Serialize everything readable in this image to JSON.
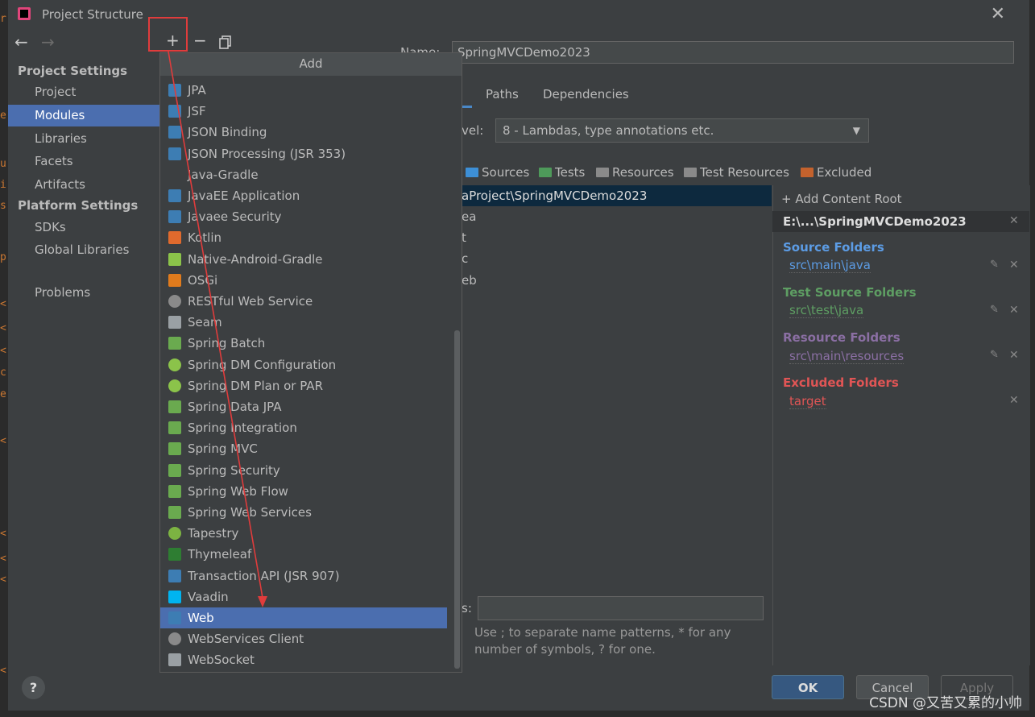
{
  "window": {
    "title": "Project Structure"
  },
  "nav": {
    "back_icon": "arrow-left-icon",
    "forward_icon": "arrow-right-icon",
    "sections": [
      {
        "header": "Project Settings",
        "items": [
          "Project",
          "Modules",
          "Libraries",
          "Facets",
          "Artifacts"
        ]
      },
      {
        "header": "Platform Settings",
        "items": [
          "SDKs",
          "Global Libraries"
        ]
      }
    ],
    "extra": "Problems",
    "selected": "Modules"
  },
  "toolbar": {
    "add": "+",
    "remove": "−",
    "copy_icon": "copy-icon"
  },
  "module": {
    "name_label": "Name:",
    "name_value": "SpringMVCDemo2023",
    "tabs": [
      "Paths",
      "Dependencies"
    ],
    "language_level_label": "vel:",
    "language_level_value": "8 - Lambdas, type annotations etc.",
    "mark_as": [
      {
        "label": "Sources",
        "color": "#3d8fd6"
      },
      {
        "label": "Tests",
        "color": "#4e9a5a"
      },
      {
        "label": "Resources",
        "color": "#8a8a8a"
      },
      {
        "label": "Test Resources",
        "color": "#8a8a8a"
      },
      {
        "label": "Excluded",
        "color": "#c4622d"
      }
    ],
    "tree": [
      "aProject\\SpringMVCDemo2023",
      "ea",
      "t",
      "c",
      "eb"
    ]
  },
  "content_root": {
    "add_label": "Add Content Root",
    "root_path": "E:\\...\\SpringMVCDemo2023",
    "groups": [
      {
        "title": "Source Folders",
        "path": "src\\main\\java",
        "color": "#5c9ce5",
        "path_color": "#5c9ce5"
      },
      {
        "title": "Test Source Folders",
        "path": "src\\test\\java",
        "color": "#5e9e63",
        "path_color": "#5e9e63"
      },
      {
        "title": "Resource Folders",
        "path": "src\\main\\resources",
        "color": "#8b6fa4",
        "path_color": "#8b6fa4"
      },
      {
        "title": "Excluded Folders",
        "path": "target",
        "color": "#e05555",
        "path_color": "#e05555"
      }
    ]
  },
  "exclude": {
    "label": "s:",
    "help_line1": "Use ; to separate name patterns, * for any",
    "help_line2": "number of symbols, ? for one."
  },
  "add_popup": {
    "title": "Add",
    "items": [
      {
        "label": "JPA",
        "icon": "jpa-icon",
        "color": "#3d7db3"
      },
      {
        "label": "JSF",
        "icon": "jsf-icon",
        "color": "#3d7db3"
      },
      {
        "label": "JSON Binding",
        "icon": "json-binding-icon",
        "color": "#3d7db3"
      },
      {
        "label": "JSON Processing (JSR 353)",
        "icon": "json-processing-icon",
        "color": "#3d7db3"
      },
      {
        "label": "Java-Gradle",
        "icon": "",
        "color": ""
      },
      {
        "label": "JavaEE Application",
        "icon": "javaee-icon",
        "color": "#3d7db3"
      },
      {
        "label": "Javaee Security",
        "icon": "javaee-security-icon",
        "color": "#3d7db3"
      },
      {
        "label": "Kotlin",
        "icon": "kotlin-icon",
        "color": "#e06a2d"
      },
      {
        "label": "Native-Android-Gradle",
        "icon": "android-icon",
        "color": "#8bc34a"
      },
      {
        "label": "OSGi",
        "icon": "osgi-icon",
        "color": "#e07b1d"
      },
      {
        "label": "RESTful Web Service",
        "icon": "globe-icon",
        "color": "#8a8a8a"
      },
      {
        "label": "Seam",
        "icon": "seam-icon",
        "color": "#9aa0a4"
      },
      {
        "label": "Spring Batch",
        "icon": "spring-leaf-icon",
        "color": "#6aaa4f"
      },
      {
        "label": "Spring DM Configuration",
        "icon": "spring-dm-icon",
        "color": "#8bc34a"
      },
      {
        "label": "Spring DM Plan or PAR",
        "icon": "spring-dm-icon",
        "color": "#8bc34a"
      },
      {
        "label": "Spring Data JPA",
        "icon": "spring-leaf-icon",
        "color": "#6aaa4f"
      },
      {
        "label": "Spring Integration",
        "icon": "spring-leaf-icon",
        "color": "#6aaa4f"
      },
      {
        "label": "Spring MVC",
        "icon": "spring-leaf-icon",
        "color": "#6aaa4f"
      },
      {
        "label": "Spring Security",
        "icon": "spring-leaf-icon",
        "color": "#6aaa4f"
      },
      {
        "label": "Spring Web Flow",
        "icon": "spring-leaf-icon",
        "color": "#6aaa4f"
      },
      {
        "label": "Spring Web Services",
        "icon": "spring-leaf-icon",
        "color": "#6aaa4f"
      },
      {
        "label": "Tapestry",
        "icon": "tapestry-icon",
        "color": "#7cb342"
      },
      {
        "label": "Thymeleaf",
        "icon": "thymeleaf-icon",
        "color": "#2e7d32"
      },
      {
        "label": "Transaction API (JSR 907)",
        "icon": "transaction-icon",
        "color": "#3d7db3"
      },
      {
        "label": "Vaadin",
        "icon": "vaadin-icon",
        "color": "#00b4f0"
      },
      {
        "label": "Web",
        "icon": "web-icon",
        "color": "#3d7db3"
      },
      {
        "label": "WebServices Client",
        "icon": "globe-icon",
        "color": "#8a8a8a"
      },
      {
        "label": "WebSocket",
        "icon": "websocket-icon",
        "color": "#9aa0a4"
      }
    ],
    "selected": "Web"
  },
  "buttons": {
    "ok": "OK",
    "cancel": "Cancel",
    "apply": "Apply",
    "help": "?"
  },
  "watermark": "CSDN @又苦又累的小帅",
  "colors": {
    "accent": "#4b6eaf",
    "annotation": "#e03c3c"
  }
}
